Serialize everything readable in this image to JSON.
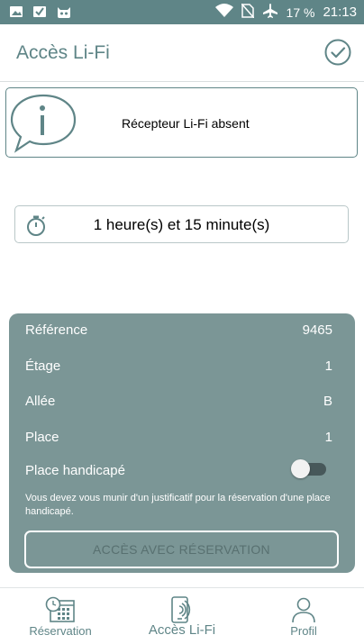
{
  "status_bar": {
    "battery": "17 %",
    "time": "21:13"
  },
  "appbar": {
    "title": "Accès Li-Fi",
    "check_icon": "check-circle-icon"
  },
  "info_card": {
    "icon": "info-bubble-icon",
    "message": "Récepteur Li-Fi absent"
  },
  "duration": {
    "icon": "stopwatch-icon",
    "text": "1 heure(s) et 15 minute(s)"
  },
  "details": {
    "rows": [
      {
        "label": "Référence",
        "value": "9465"
      },
      {
        "label": "Étage",
        "value": "1"
      },
      {
        "label": "Allée",
        "value": "B"
      },
      {
        "label": "Place",
        "value": "1"
      }
    ],
    "handicap_label": "Place handicapé",
    "handicap_enabled": false,
    "notice": "Vous devez vous munir d'un justificatif pour la réservation d'une place handicapé.",
    "button_label": "ACCÈS AVEC RÉSERVATION"
  },
  "nav": {
    "items": [
      {
        "label": "Réservation",
        "icon": "calendar-clock-icon"
      },
      {
        "label": "Accès Li-Fi",
        "icon": "phone-signal-icon"
      },
      {
        "label": "Profil",
        "icon": "user-icon"
      }
    ]
  },
  "colors": {
    "accent": "#5f8587",
    "panel": "#7b9696"
  }
}
